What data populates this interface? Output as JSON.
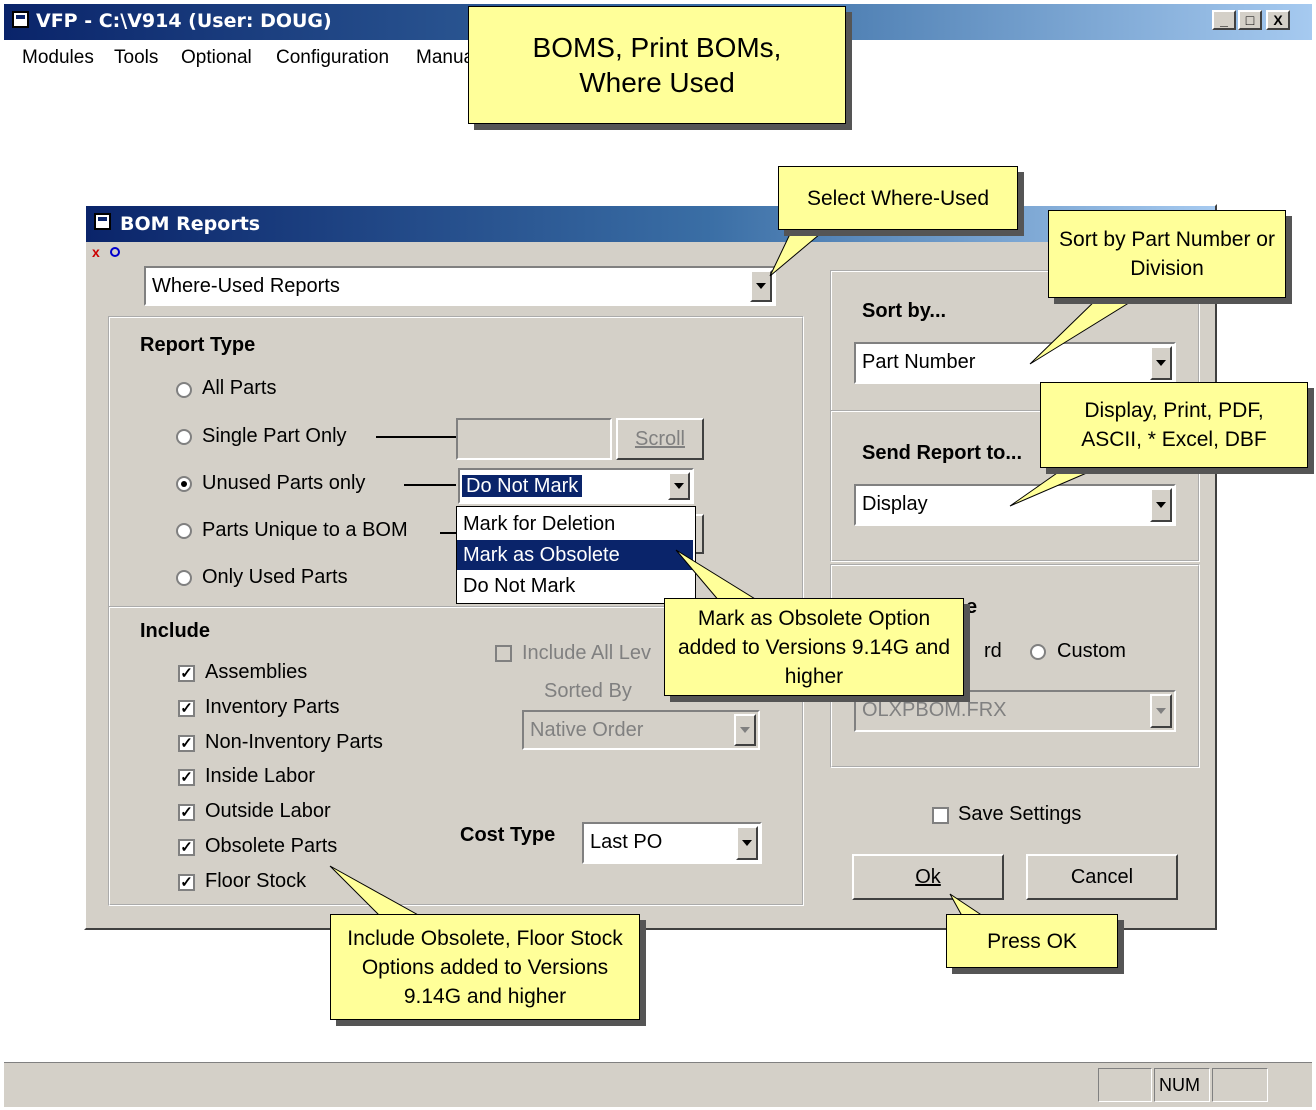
{
  "window": {
    "title": "VFP - C:\\V914  (User: DOUG)",
    "controls": [
      "_",
      "□",
      "X"
    ]
  },
  "menu": [
    "Modules",
    "Tools",
    "Optional",
    "Configuration",
    "Manua"
  ],
  "status": {
    "num": "NUM"
  },
  "dialog": {
    "title": "BOM Reports",
    "report_combo": "Where-Used Reports",
    "report_type": {
      "heading": "Report Type",
      "options": [
        "All Parts",
        "Single Part Only",
        "Unused Parts only",
        "Parts Unique to a BOM",
        "Only Used Parts"
      ],
      "selected": "Unused Parts only",
      "scroll_button": "Scroll",
      "unused_combo": "Do Not Mark",
      "dropdown_options": [
        "Mark for Deletion",
        "Mark as Obsolete",
        "Do Not Mark"
      ],
      "dropdown_selected": "Mark as Obsolete"
    },
    "include": {
      "heading": "Include",
      "items": [
        "Assemblies",
        "Inventory Parts",
        "Non-Inventory Parts",
        "Inside Labor",
        "Outside Labor",
        "Obsolete Parts",
        "Floor Stock"
      ],
      "include_all_levels": "Include All Lev",
      "sorted_by_label": "Sorted By",
      "sorted_by_value": "Native Order",
      "cost_type_label": "Cost Type",
      "cost_type_value": "Last PO"
    },
    "sort_by": {
      "heading": "Sort by...",
      "value": "Part Number"
    },
    "send_to": {
      "heading": "Send Report to...",
      "value": "Display"
    },
    "type_group": {
      "heading_fragment": "e",
      "standard_fragment": "rd",
      "custom": "Custom",
      "file_value": "OLXPBOM.FRX"
    },
    "save_settings": "Save Settings",
    "ok": "Ok",
    "cancel": "Cancel"
  },
  "callouts": {
    "main": "BOMS, Print BOMs, Where Used",
    "select_where_used": "Select Where-Used",
    "sort_by": "Sort by Part Number or Division",
    "send_to": "Display, Print, PDF, ASCII, * Excel, DBF",
    "obsolete_option": "Mark as Obsolete Option added to Versions 9.14G and higher",
    "include_options": "Include Obsolete, Floor Stock Options added to Versions 9.14G and higher",
    "press_ok": "Press OK"
  },
  "colors": {
    "title_start": "#0a246a",
    "title_end": "#a6caf0",
    "callout": "#ffff99",
    "face": "#d4d0c8"
  }
}
